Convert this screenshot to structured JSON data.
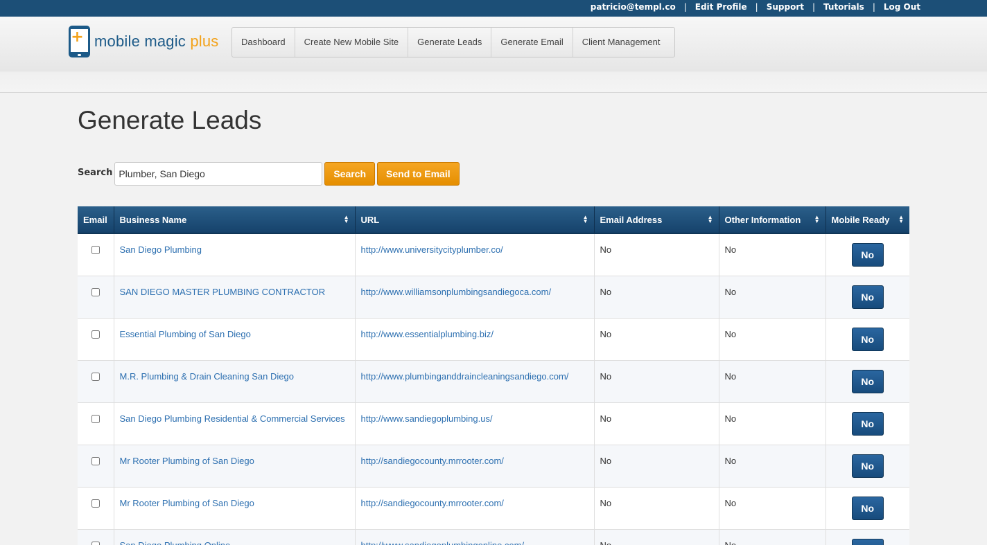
{
  "topnav": {
    "user": "patricio@templ.co",
    "links": [
      "Edit Profile",
      "Support",
      "Tutorials",
      "Log Out"
    ],
    "separator": "|"
  },
  "logo": {
    "text_main": "mobile magic",
    "text_accent": "plus",
    "icon_glyph": "+",
    "icon": "phone-plus-icon"
  },
  "mainnav": [
    "Dashboard",
    "Create New Mobile Site",
    "Generate Leads",
    "Generate Email",
    "Client Management"
  ],
  "page": {
    "title": "Generate Leads"
  },
  "search": {
    "label": "Search",
    "value": "Plumber, San Diego",
    "search_button": "Search",
    "send_button": "Send to Email"
  },
  "table": {
    "columns": [
      "Email",
      "Business Name",
      "URL",
      "Email Address",
      "Other Information",
      "Mobile Ready"
    ],
    "rows": [
      {
        "name": "San Diego Plumbing",
        "url": "http://www.universitycityplumber.co/",
        "email": "No",
        "other": "No",
        "mobile": "No"
      },
      {
        "name": "SAN DIEGO MASTER PLUMBING CONTRACTOR",
        "url": "http://www.williamsonplumbingsandiegoca.com/",
        "email": "No",
        "other": "No",
        "mobile": "No"
      },
      {
        "name": "Essential Plumbing of San Diego",
        "url": "http://www.essentialplumbing.biz/",
        "email": "No",
        "other": "No",
        "mobile": "No"
      },
      {
        "name": "M.R. Plumbing & Drain Cleaning San Diego",
        "url": "http://www.plumbinganddraincleaningsandiego.com/",
        "email": "No",
        "other": "No",
        "mobile": "No"
      },
      {
        "name": "San Diego Plumbing Residential & Commercial Services",
        "url": "http://www.sandiegoplumbing.us/",
        "email": "No",
        "other": "No",
        "mobile": "No"
      },
      {
        "name": "Mr Rooter Plumbing of San Diego",
        "url": "http://sandiegocounty.mrrooter.com/",
        "email": "No",
        "other": "No",
        "mobile": "No"
      },
      {
        "name": "Mr Rooter Plumbing of San Diego",
        "url": "http://sandiegocounty.mrrooter.com/",
        "email": "No",
        "other": "No",
        "mobile": "No"
      },
      {
        "name": "San Diego Plumbing Online",
        "url": "http://www.sandiegoplumbingonline.com/",
        "email": "No",
        "other": "No",
        "mobile": "No"
      }
    ]
  },
  "colors": {
    "topbar": "#1c4f77",
    "accent_orange": "#f3a21a",
    "link_blue": "#2c6fb0",
    "header_blue": "#1c4f77"
  }
}
